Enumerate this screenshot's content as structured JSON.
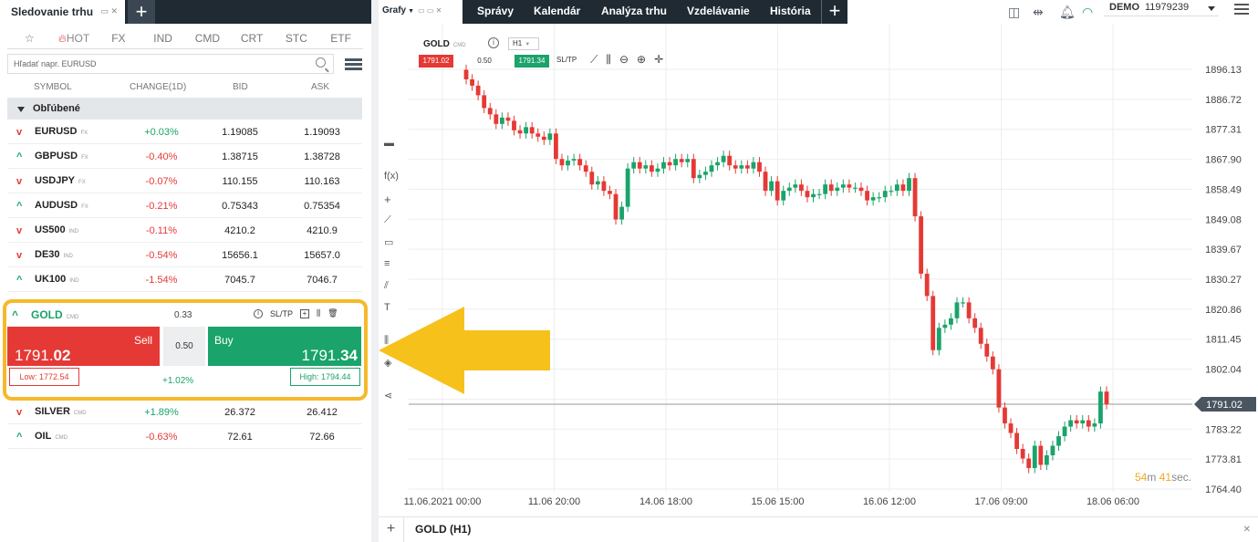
{
  "left_panel": {
    "tab_title": "Sledovanie trhu",
    "filters": [
      "☆",
      "HOT",
      "FX",
      "IND",
      "CMD",
      "CRT",
      "STC",
      "ETF"
    ],
    "search_placeholder": "Hľadať napr. EURUSD",
    "columns": {
      "symbol": "SYMBOL",
      "change": "CHANGE(1D)",
      "bid": "BID",
      "ask": "ASK"
    },
    "group": "Obľúbené",
    "rows": [
      {
        "symbol": "EURUSD",
        "type": "FX",
        "dir": "down",
        "change": "+0.03%",
        "change_sign": "pos",
        "bid": "1.19085",
        "ask": "1.19093"
      },
      {
        "symbol": "GBPUSD",
        "type": "FX",
        "dir": "up",
        "change": "-0.40%",
        "change_sign": "neg",
        "bid": "1.38715",
        "ask": "1.38728"
      },
      {
        "symbol": "USDJPY",
        "type": "FX",
        "dir": "down",
        "change": "-0.07%",
        "change_sign": "neg",
        "bid": "110.155",
        "ask": "110.163"
      },
      {
        "symbol": "AUDUSD",
        "type": "FX",
        "dir": "up",
        "change": "-0.21%",
        "change_sign": "neg",
        "bid": "0.75343",
        "ask": "0.75354"
      },
      {
        "symbol": "US500",
        "type": "IND",
        "dir": "down",
        "change": "-0.11%",
        "change_sign": "neg",
        "bid": "4210.2",
        "ask": "4210.9"
      },
      {
        "symbol": "DE30",
        "type": "IND",
        "dir": "down",
        "change": "-0.54%",
        "change_sign": "neg",
        "bid": "15656.1",
        "ask": "15657.0"
      },
      {
        "symbol": "UK100",
        "type": "IND",
        "dir": "up",
        "change": "-1.54%",
        "change_sign": "neg",
        "bid": "7045.7",
        "ask": "7046.7"
      }
    ],
    "gold": {
      "symbol": "GOLD",
      "type": "CMD",
      "spread": "0.33",
      "sltp": "SL/TP",
      "sell_label": "Sell",
      "sell_price_main": "1791.",
      "sell_price_big": "02",
      "lot": "0.50",
      "buy_label": "Buy",
      "buy_price_main": "1791.",
      "buy_price_big": "34",
      "low": "Low: 1772.54",
      "high": "High: 1794.44",
      "change": "+1.02%"
    },
    "rows_after": [
      {
        "symbol": "SILVER",
        "type": "CMD",
        "dir": "down",
        "change": "+1.89%",
        "change_sign": "pos",
        "bid": "26.372",
        "ask": "26.412"
      },
      {
        "symbol": "OIL",
        "type": "CMD",
        "dir": "up",
        "change": "-0.63%",
        "change_sign": "neg",
        "bid": "72.61",
        "ask": "72.66"
      }
    ]
  },
  "top_nav": {
    "grafy": "Grafy",
    "items": [
      "Správy",
      "Kalendár",
      "Analýza trhu",
      "Vzdelávanie",
      "História"
    ],
    "account_mode": "DEMO",
    "account_number": "11979239"
  },
  "chart": {
    "symbol": "GOLD",
    "symbol_type": "CMD",
    "timeframe": "H1",
    "sell_price": "1791.02",
    "lot": "0.50",
    "buy_price": "1791.34",
    "sltp": "SL/TP",
    "countdown_min": "54",
    "countdown_min_unit": "m",
    "countdown_sec": "41",
    "countdown_sec_unit": "sec.",
    "bottom_tab": "GOLD (H1)"
  },
  "colors": {
    "up": "#1aa36a",
    "down": "#e53935",
    "highlight": "#f5b92b",
    "arrow": "#f7c11c",
    "nav": "#1f2a33"
  },
  "chart_data": {
    "type": "candlestick",
    "y_ticks": [
      1896.13,
      1886.72,
      1877.31,
      1867.9,
      1858.49,
      1849.08,
      1839.67,
      1830.27,
      1820.86,
      1811.45,
      1802.04,
      1792.63,
      1783.22,
      1773.81,
      1764.4
    ],
    "y_tick_labels": [
      "1896.13",
      "1886.72",
      "1877.31",
      "1867.90",
      "1858.49",
      "1849.08",
      "1839.67",
      "1830.27",
      "1820.86",
      "1811.45",
      "1802.04",
      "1783.22",
      "1773.81",
      "1764.40"
    ],
    "ylim": [
      1764.4,
      1896.13
    ],
    "x_tick_labels": [
      "11.06.2021 00:00",
      "11.06 20:00",
      "14.06 18:00",
      "15.06 15:00",
      "16.06 12:00",
      "17.06 09:00",
      "18.06 06:00"
    ],
    "current_price": 1791.02,
    "current_price_label": "1791.02",
    "closes": [
      1893.0,
      1891.0,
      1888.0,
      1884.0,
      1882.0,
      1879.0,
      1881.0,
      1880.0,
      1877.0,
      1876.0,
      1878.0,
      1876.0,
      1875.0,
      1874.0,
      1876.0,
      1868.0,
      1866.0,
      1867.5,
      1868.0,
      1866.0,
      1864.0,
      1860.0,
      1861.0,
      1858.0,
      1857.0,
      1849.0,
      1853.0,
      1865.0,
      1867.0,
      1865.0,
      1866.0,
      1864.0,
      1865.0,
      1867.0,
      1866.0,
      1868.0,
      1867.0,
      1868.0,
      1862.0,
      1863.0,
      1864.0,
      1866.0,
      1867.0,
      1869.0,
      1866.0,
      1865.0,
      1866.0,
      1865.0,
      1867.0,
      1864.0,
      1858.0,
      1861.0,
      1855.0,
      1858.0,
      1859.0,
      1860.0,
      1858.0,
      1856.0,
      1857.0,
      1857.0,
      1860.0,
      1858.0,
      1859.0,
      1860.0,
      1859.0,
      1859.0,
      1858.0,
      1855.0,
      1856.0,
      1856.0,
      1858.0,
      1858.0,
      1860.0,
      1858.0,
      1862.0,
      1850.0,
      1832.0,
      1825.0,
      1808.0,
      1815.0,
      1816.0,
      1818.0,
      1823.0,
      1823.0,
      1818.0,
      1815.0,
      1810.0,
      1806.0,
      1802.0,
      1790.0,
      1785.0,
      1782.0,
      1777.0,
      1774.0,
      1771.0,
      1778.0,
      1772.0,
      1775.0,
      1778.0,
      1781.0,
      1784.0,
      1786.0,
      1785.0,
      1786.0,
      1784.0,
      1785.0,
      1795.0,
      1791.02
    ]
  }
}
